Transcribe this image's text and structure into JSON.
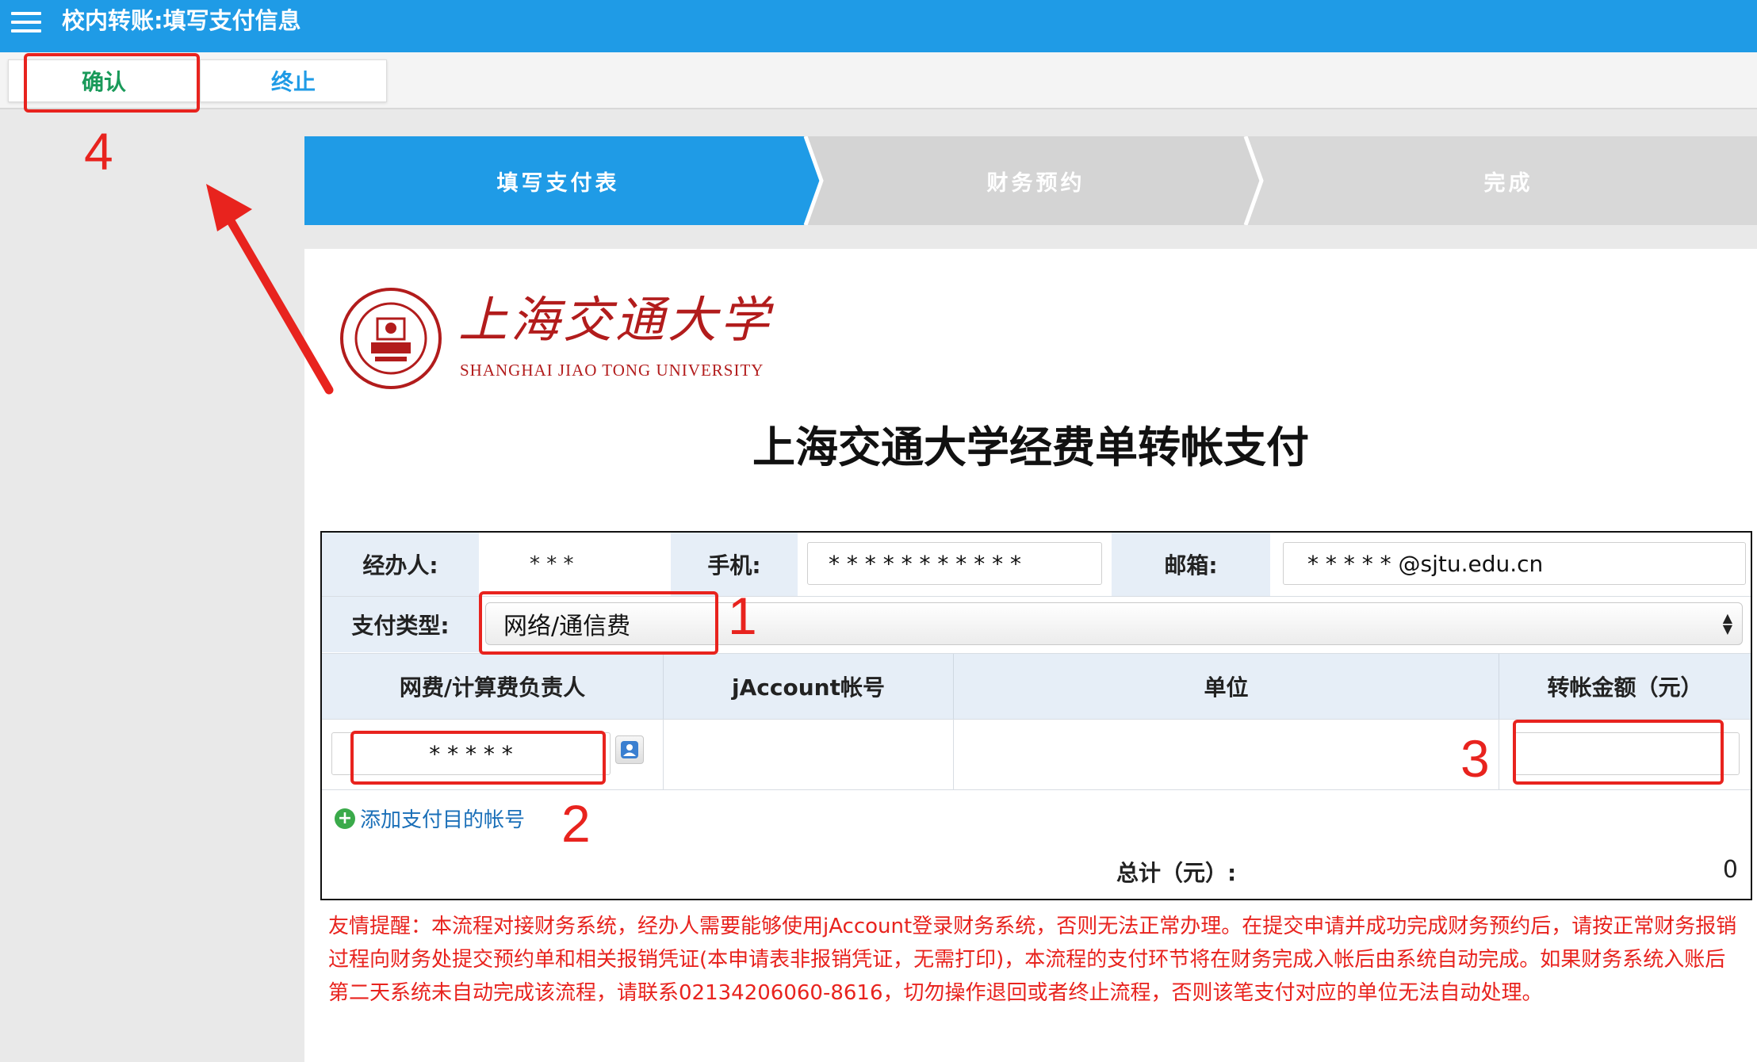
{
  "titlebar": {
    "title": "校内转账:填写支付信息",
    "menu_icon": "hamburger-menu-icon"
  },
  "toolbar": {
    "confirm_label": "确认",
    "stop_label": "终止"
  },
  "annotations": {
    "n1": "1",
    "n2": "2",
    "n3": "3",
    "n4": "4"
  },
  "steps": [
    {
      "label": "填写支付表",
      "state": "active"
    },
    {
      "label": "财务预约",
      "state": "pending"
    },
    {
      "label": "完成",
      "state": "pending"
    }
  ],
  "logo": {
    "cn": "上海交通大学",
    "en": "SHANGHAI JIAO TONG UNIVERSITY"
  },
  "form": {
    "title": "上海交通大学经费单转帐支付",
    "handler_label": "经办人:",
    "handler_value": "* * *",
    "phone_label": "手机:",
    "phone_value": "* * * * * * * * * * *",
    "email_label": "邮箱:",
    "email_value": "* * * * *  @sjtu.edu.cn",
    "pay_type_label": "支付类型:",
    "pay_type_value": "网络/通信费",
    "columns": [
      "网费/计算费负责人",
      "jAccount帐号",
      "单位",
      "转帐金额（元）"
    ],
    "row": {
      "responsible": "* * * * *",
      "jaccount": "",
      "unit": "",
      "amount": ""
    },
    "add_link": "添加支付目的帐号",
    "total_label": "总计（元）:",
    "total_value": "0"
  },
  "notice": "友情提醒：本流程对接财务系统，经办人需要能够使用jAccount登录财务系统，否则无法正常办理。在提交申请并成功完成财务预约后，请按正常财务报销过程向财务处提交预约单和相关报销凭证(本申请表非报销凭证，无需打印)，本流程的支付环节将在财务完成入帐后由系统自动完成。如果财务系统入账后第二天系统未自动完成该流程，请联系02134206060-8616，切勿操作退回或者终止流程，否则该笔支付对应的单位无法自动处理。",
  "colors": {
    "brand": "#1f9be6",
    "confirm": "#1a9a5a",
    "annotation": "#e8231e",
    "logo": "#b21c1c"
  }
}
